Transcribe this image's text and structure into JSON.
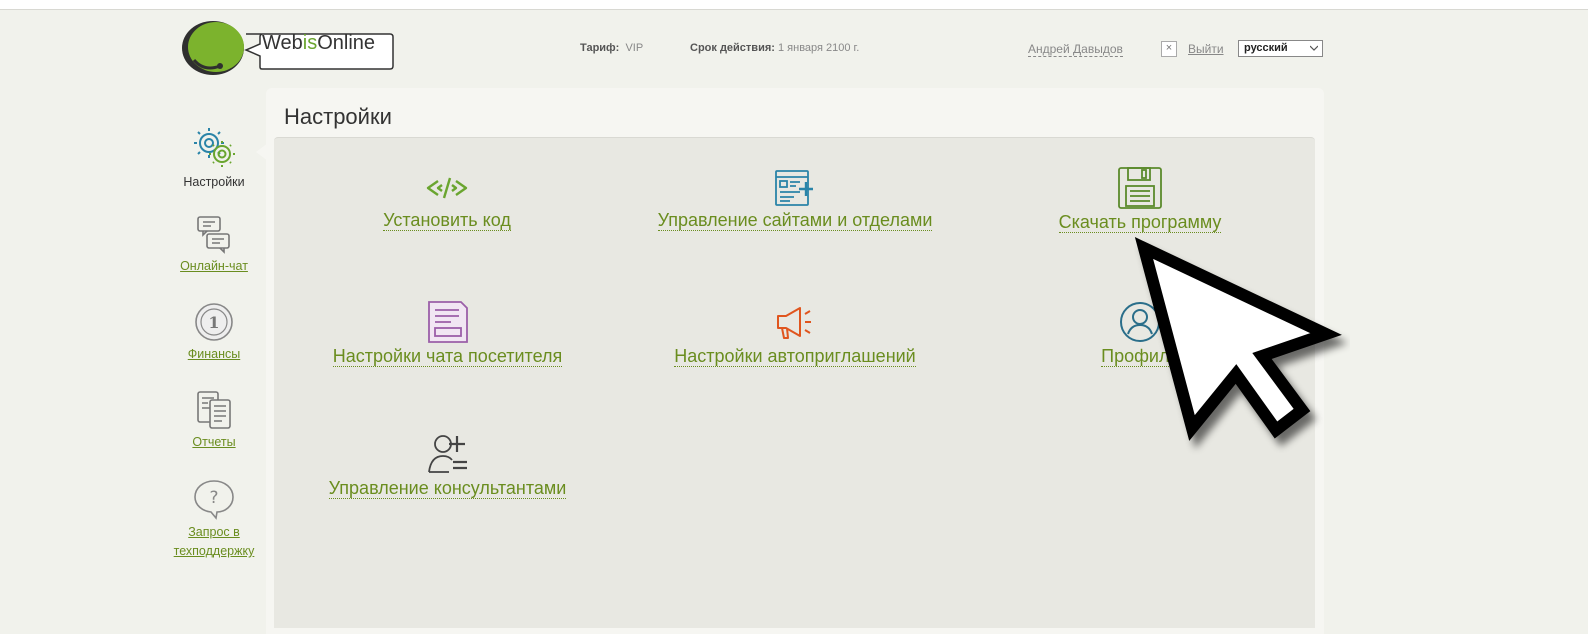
{
  "header": {
    "logo": {
      "web": "Web",
      "is": "is",
      "online": "Online"
    },
    "tariff_label": "Тариф:",
    "tariff_value": "VIP",
    "validity_label": "Срок действия:",
    "validity_value": "1 января 2100 г.",
    "user_name": "Андрей Давыдов",
    "close_icon": "×",
    "logout_label": "Выйти",
    "language": {
      "selected": "русский"
    }
  },
  "sidebar": {
    "items": [
      {
        "label": "Настройки",
        "icon": "gears-icon",
        "active": true
      },
      {
        "label": "Онлайн-чат",
        "icon": "chat-bubbles-icon",
        "active": false
      },
      {
        "label": "Финансы",
        "icon": "coin-icon",
        "active": false
      },
      {
        "label": "Отчеты",
        "icon": "reports-icon",
        "active": false
      },
      {
        "label": "Запрос в",
        "label2": "техподдержку",
        "icon": "question-bubble-icon",
        "active": false
      }
    ]
  },
  "main": {
    "title": "Настройки",
    "tiles": [
      {
        "label": "Установить код",
        "icon": "code-icon",
        "color": "#6aa52f"
      },
      {
        "label": "Управление сайтами и отделами",
        "icon": "sites-icon",
        "color": "#2a84a8"
      },
      {
        "label": "Скачать программу",
        "icon": "floppy-disk-icon",
        "color": "#5b8a2c"
      },
      {
        "label": "Настройки чата посетителя",
        "icon": "chat-window-icon",
        "color": "#9b5fa8"
      },
      {
        "label": "Настройки автоприглашений",
        "icon": "megaphone-icon",
        "color": "#e0551e"
      },
      {
        "label": "Профиль",
        "icon": "profile-icon",
        "color": "#2a6e8a"
      },
      {
        "label": "Управление консультантами",
        "icon": "add-user-icon",
        "color": "#444444"
      }
    ]
  },
  "colors": {
    "accent_green": "#6a8d1f",
    "background": "#f1f2ec",
    "panel": "#e8e8e2"
  }
}
